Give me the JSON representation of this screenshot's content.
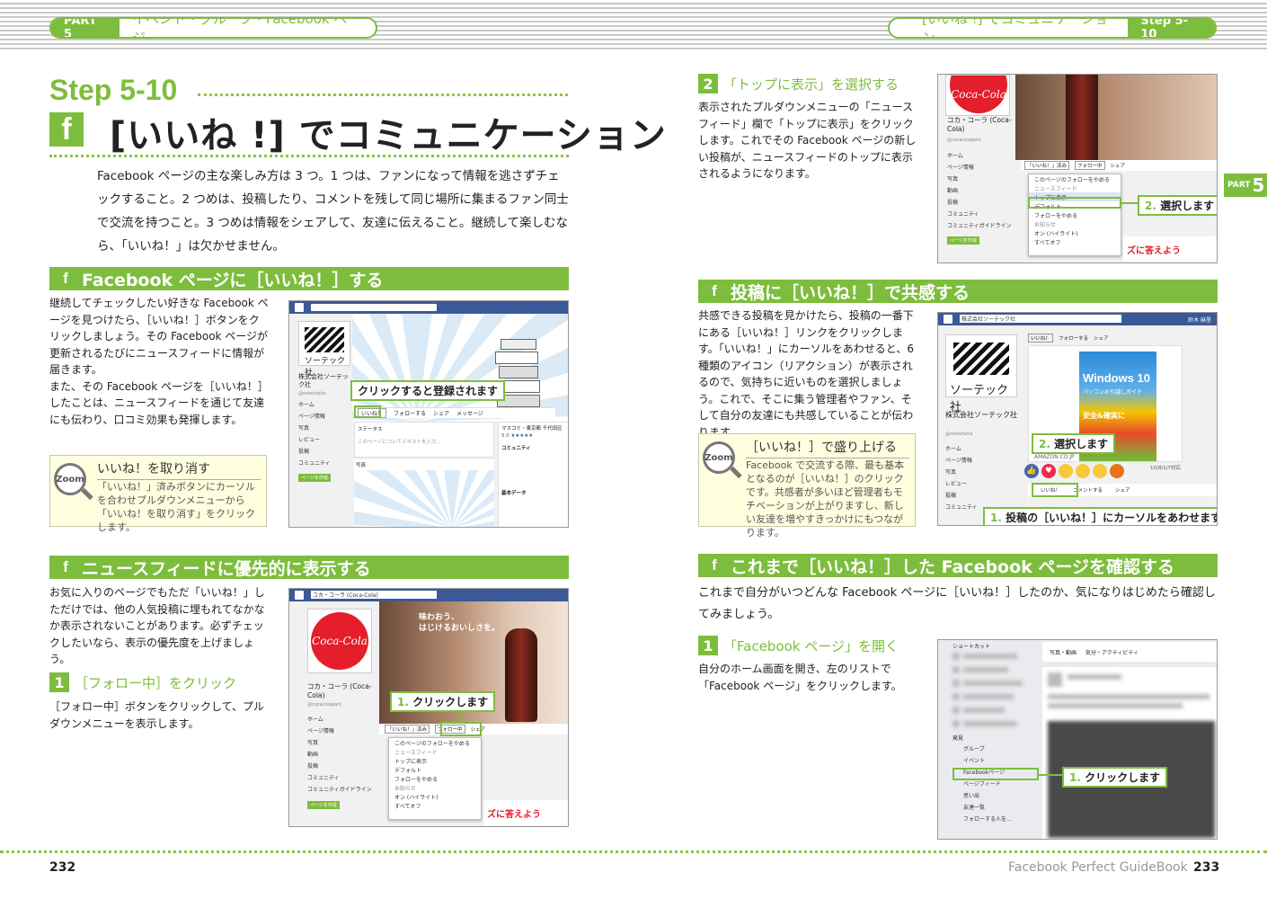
{
  "header": {
    "left_tag": "PART 5",
    "left_text": "イベント・グループ・Facebook ページ",
    "right_text": "[いいね !] でコミュニケーション",
    "right_tag": "Step 5-10"
  },
  "step": {
    "number": "Step 5-10",
    "fb_glyph": "f",
    "title": "[いいね !] でコミュニケーション"
  },
  "intro": "Facebook ページの主な楽しみ方は 3 つ。1 つは、ファンになって情報を逃さずチェックすること。2 つめは、投稿したり、コメントを残して同じ場所に集まるファン同士で交流を持つこと。3 つめは情報をシェアして、友達に伝えること。継続して楽しむなら、「いいね！」は欠かせません。",
  "sec1": {
    "title": "Facebook ページに［いいね！］する",
    "body": "継続してチェックしたい好きな Facebook ページを見つけたら、［いいね！］ボタンをクリックしましょう。その Facebook ページが更新されるたびにニュースフィードに情報が届きます。\nまた、その Facebook ページを［いいね！］したことは、ニュースフィードを通じて友達にも伝わり、口コミ効果も発揮します。",
    "zoom": {
      "lens": "Zoom",
      "title": "いいね！を取り消す",
      "text": "「いいね！」済みボタンにカーソルを合わせプルダウンメニューから「いいね！を取り消す」をクリックします。"
    },
    "callout": "クリックすると登録されます",
    "shot": {
      "company": "株式会社ソーテック社",
      "handle": "@sotechsha",
      "logo": "ソーテック社",
      "menu": [
        "ホーム",
        "ページ情報",
        "写真",
        "レビュー",
        "投稿",
        "コミュニティ"
      ],
      "button": "ページを作成",
      "like": "いいね！",
      "follow": "フォローする",
      "share": "シェア",
      "msg": "メッセージ",
      "status": "ステータス",
      "post_ph": "このページについてテキストを入力...",
      "photos": "写真",
      "place": "マスコミ・東京都 千代田区",
      "rating": "5.0 ★★★★★",
      "community": "コミュニティ",
      "basic": "基本データ"
    }
  },
  "sec2": {
    "title": "ニュースフィードに優先的に表示する",
    "body": "お気に入りのページでもただ「いいね！」しただけでは、他の人気投稿に埋もれてなかなか表示されないことがあります。必ずチェックしたいなら、表示の優先度を上げましょう。",
    "step1_num": "1",
    "step1_title": "［フォロー中］をクリック",
    "step1_body": "［フォロー中］ボタンをクリックして、プルダウンメニューを表示します。",
    "callout_num": "1.",
    "callout": "クリックします",
    "shot": {
      "topbar": "コカ・コーラ (Coca-Cola)",
      "name": "コカ・コーラ (Coca-Cola)",
      "handle": "@cocacolapark",
      "logo": "Coca-Cola",
      "menu": [
        "ホーム",
        "ページ情報",
        "写真",
        "動画",
        "投稿",
        "コミュニティ",
        "コミュニティガイドライン"
      ],
      "button": "ページを作成",
      "liked": "「いいね！」済み",
      "following": "フォロー中",
      "share": "シェア",
      "slogan1": "味わおう、",
      "slogan2": "はじけるおいしさを。",
      "dropdown": [
        "このページのフォローをやめる",
        "ニュースフィード",
        "トップに表示",
        "デフォルト",
        "フォローをやめる",
        "お知らせ",
        "オン (ハイライト)",
        "すべてオフ"
      ],
      "banner": "ズに答えよう"
    }
  },
  "step2": {
    "num": "2",
    "title": "「トップに表示」を選択する",
    "body": "表示されたプルダウンメニューの「ニュースフィード」欄で「トップに表示」をクリックします。これでその Facebook ページの新しい投稿が、ニュースフィードのトップに表示されるようになります。",
    "callout_num": "2.",
    "callout": "選択します"
  },
  "sec3": {
    "title": "投稿に［いいね！］で共感する",
    "body": "共感できる投稿を見かけたら、投稿の一番下にある［いいね！］リンクをクリックします。「いいね！」にカーソルをあわせると、6 種類のアイコン（リアクション）が表示されるので、気持ちに近いものを選択しましょう。これで、そこに集う管理者やファン、そして自分の友達にも共感していることが伝わります。",
    "zoom": {
      "lens": "Zoom",
      "title": "［いいね！］で盛り上げる",
      "text": "Facebook で交流する際、最も基本となるのが［いいね！］のクリックです。共感者が多いほど管理者もモチベーションが上がりますし、新しい友達を増やすきっかけにもつながります。"
    },
    "callout2_num": "2.",
    "callout2": "選択します",
    "callout1_num": "1.",
    "callout1": "投稿の［いいね！］にカーソルをあわせます",
    "shot": {
      "topbar": "株式会社ソーテック社",
      "user": "鈴木 麻里",
      "company": "株式会社ソーテック社",
      "logo": "ソーテック社",
      "handle": "@sotechsha",
      "menu": [
        "ホーム",
        "ページ情報",
        "写真",
        "レビュー",
        "投稿",
        "コミュニティ"
      ],
      "liked": "いいね！",
      "follow": "フォローする",
      "share": "シェア",
      "book1": "Windows 10",
      "book2": "パソコンお引越しガイド",
      "book3": "安全&確実に",
      "amazon": "AMAZON.CO.JP",
      "comment": "コメントする",
      "date": "10/8/1/7対応"
    }
  },
  "sec4": {
    "title": "これまで［いいね！］した Facebook ページを確認する",
    "body": "これまで自分がいつどんな Facebook ページに［いいね！］したのか、気になりはじめたら確認してみましょう。",
    "step1_num": "1",
    "step1_title": "「Facebook ページ」を開く",
    "step1_body": "自分のホーム画面を開き、左のリストで「Facebook ページ」をクリックします。",
    "callout_num": "1.",
    "callout": "クリックします",
    "shot": {
      "shortcut": "ショートカット",
      "photo": "写真・動画",
      "feeling": "気分・アクティビティ",
      "discover": "発見",
      "items": [
        "グループ",
        "イベント",
        "Facebookページ",
        "ページフィード",
        "思い出",
        "友達一覧",
        "フォローする人を..."
      ]
    }
  },
  "footer": {
    "left_page": "232",
    "book": "Facebook Perfect GuideBook",
    "right_page": "233"
  },
  "side_tab": {
    "part": "PART",
    "num": "5"
  },
  "colors": {
    "accent": "#7dbd3d",
    "fb_blue": "#3b5998",
    "coke_red": "#e41e2b"
  }
}
